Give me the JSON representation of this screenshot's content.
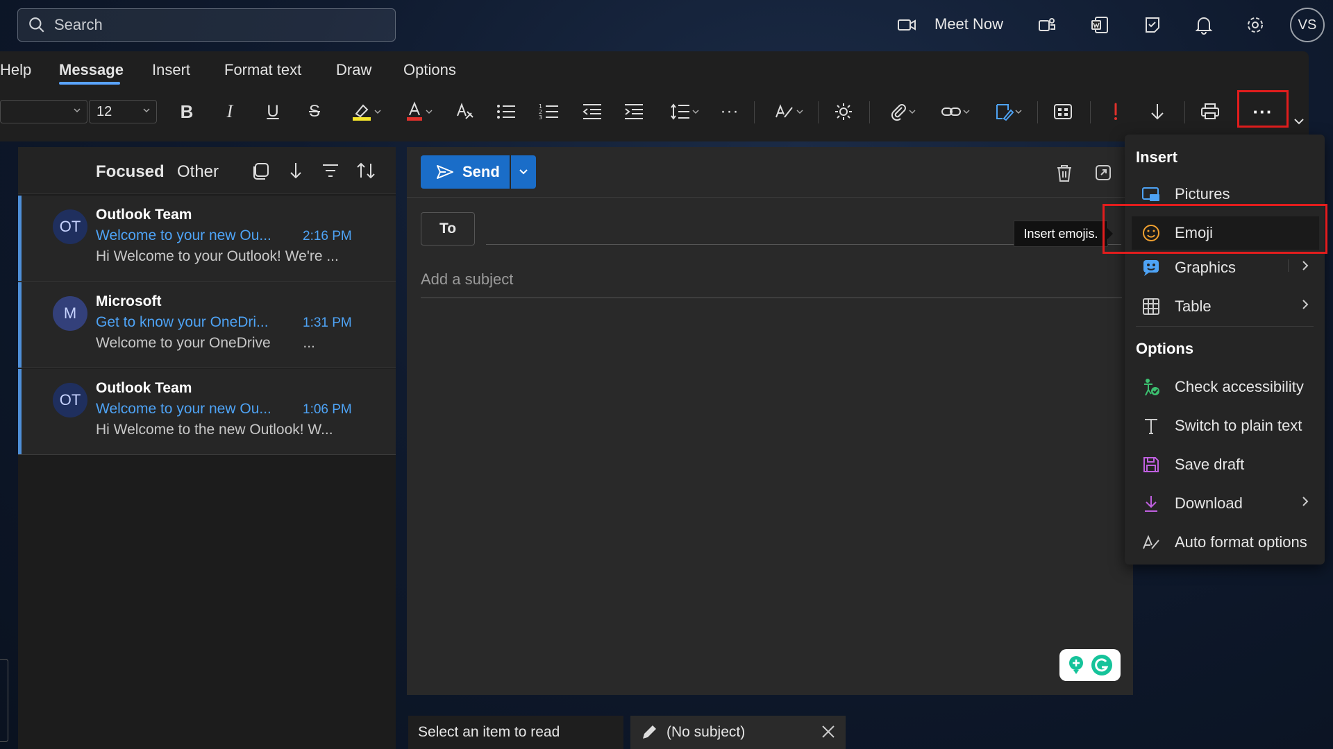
{
  "topbar": {
    "search_placeholder": "Search",
    "meet_now": "Meet Now",
    "avatar_initials": "VS"
  },
  "ribbon": {
    "tabs": [
      {
        "label": "Help"
      },
      {
        "label": "Message"
      },
      {
        "label": "Insert"
      },
      {
        "label": "Format text"
      },
      {
        "label": "Draw"
      },
      {
        "label": "Options"
      }
    ],
    "active_tab": "Message",
    "font_size": "12"
  },
  "mail_list": {
    "tabs": {
      "focused": "Focused",
      "other": "Other"
    },
    "items": [
      {
        "initials": "OT",
        "sender": "Outlook Team",
        "subject": "Welcome to your new Ou...",
        "time": "2:16 PM",
        "preview": "Hi Welcome to your Outlook! We're ..."
      },
      {
        "initials": "M",
        "sender": "Microsoft",
        "subject": "Get to know your OneDri...",
        "time": "1:31 PM",
        "preview": "Welcome to your OneDrive        ..."
      },
      {
        "initials": "OT",
        "sender": "Outlook Team",
        "subject": "Welcome to your new Ou...",
        "time": "1:06 PM",
        "preview": "Hi Welcome to the new Outlook! W..."
      }
    ]
  },
  "compose": {
    "send_label": "Send",
    "to_label": "To",
    "subject_placeholder": "Add a subject",
    "tooltip": "Insert emojis."
  },
  "bottom_tabs": {
    "reading": "Select an item to read",
    "draft": "(No subject)"
  },
  "menu": {
    "insert_heading": "Insert",
    "insert_items": [
      {
        "label": "Pictures",
        "icon": "pictures-icon"
      },
      {
        "label": "Emoji",
        "icon": "emoji-icon"
      },
      {
        "label": "Graphics",
        "icon": "graphics-icon"
      },
      {
        "label": "Table",
        "icon": "table-icon"
      }
    ],
    "options_heading": "Options",
    "options_items": [
      {
        "label": "Check accessibility",
        "icon": "accessibility-icon"
      },
      {
        "label": "Switch to plain text",
        "icon": "plain-text-icon"
      },
      {
        "label": "Save draft",
        "icon": "save-icon"
      },
      {
        "label": "Download",
        "icon": "download-icon"
      },
      {
        "label": "Auto format options",
        "icon": "auto-format-icon"
      }
    ]
  },
  "colors": {
    "accent": "#1a6dc8",
    "link": "#4ea3f5",
    "highlight_box": "#e21d1d"
  }
}
